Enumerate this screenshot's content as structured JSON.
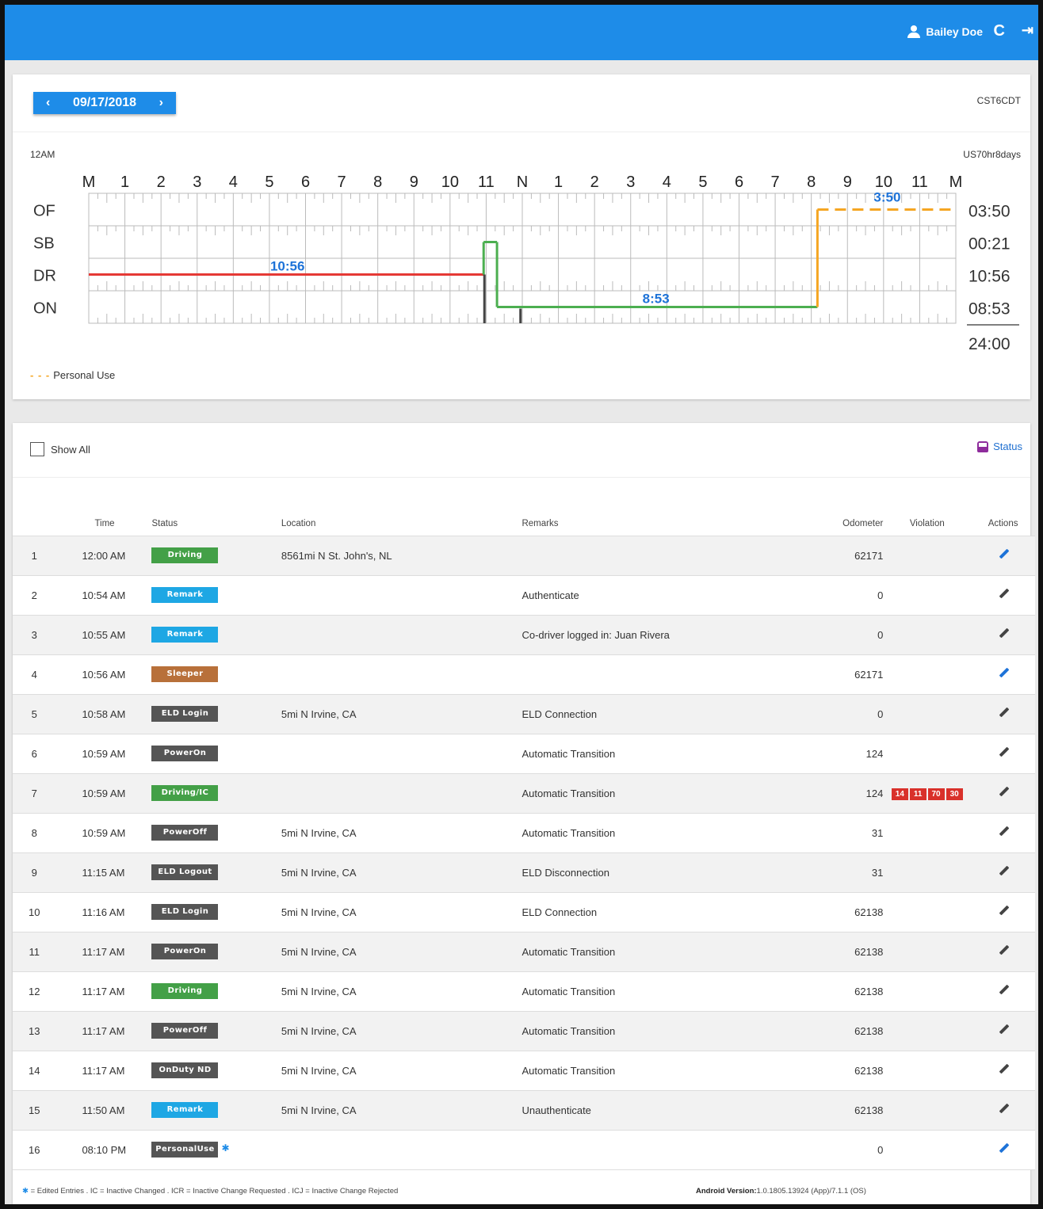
{
  "header": {
    "user_name": "Bailey Doe",
    "refresh_icon": "C",
    "logout_icon": "⇥"
  },
  "chart": {
    "date": "09/17/2018",
    "timezone": "CST6CDT",
    "start_label": "12AM",
    "ruleset": "US70hr8days",
    "hour_labels": [
      "M",
      "1",
      "2",
      "3",
      "4",
      "5",
      "6",
      "7",
      "8",
      "9",
      "10",
      "11",
      "N",
      "1",
      "2",
      "3",
      "4",
      "5",
      "6",
      "7",
      "8",
      "9",
      "10",
      "11",
      "M"
    ],
    "rows": [
      "OF",
      "SB",
      "DR",
      "ON"
    ],
    "totals": [
      "03:50",
      "00:21",
      "10:56",
      "08:53"
    ],
    "grand_total": "24:00",
    "duration_labels": {
      "dr": "10:56",
      "on": "8:53",
      "of": "3:50"
    },
    "legend": "Personal Use",
    "colors": {
      "driving": "#e53935",
      "onduty": "#4caf50",
      "personal": "#f5a623",
      "label": "#1e73d8"
    }
  },
  "chart_data": {
    "type": "line",
    "title": "",
    "xlabel": "",
    "ylabel": "",
    "xlim": [
      0,
      24
    ],
    "categories": [
      "OF",
      "SB",
      "DR",
      "ON"
    ],
    "series": [
      {
        "name": "",
        "status": "DR",
        "start_hour": 0.0,
        "end_hour": 10.93
      },
      {
        "name": "",
        "status": "SB",
        "start_hour": 10.93,
        "end_hour": 11.3
      },
      {
        "name": "",
        "status": "ON",
        "start_hour": 11.3,
        "end_hour": 20.17
      },
      {
        "name": "Personal Use",
        "status": "OF",
        "start_hour": 20.17,
        "end_hour": 24.0
      }
    ]
  },
  "log": {
    "show_all_label": "Show All",
    "status_link": "Status",
    "columns": [
      "",
      "Time",
      "Status",
      "Location",
      "Remarks",
      "Odometer",
      "Violation",
      "Actions"
    ],
    "rows": [
      {
        "num": "1",
        "time": "12:00 AM",
        "status": "Driving",
        "color": "#43a047",
        "location": "8561mi N St. John's, NL",
        "remarks": "",
        "odometer": "62171",
        "violations": [],
        "action": "blue",
        "edited": false
      },
      {
        "num": "2",
        "time": "10:54 AM",
        "status": "Remark",
        "color": "#1ea7e4",
        "location": "",
        "remarks": "Authenticate",
        "odometer": "0",
        "violations": [],
        "action": "dark",
        "edited": false
      },
      {
        "num": "3",
        "time": "10:55 AM",
        "status": "Remark",
        "color": "#1ea7e4",
        "location": "",
        "remarks": "Co-driver logged in: Juan Rivera",
        "odometer": "0",
        "violations": [],
        "action": "dark",
        "edited": false
      },
      {
        "num": "4",
        "time": "10:56 AM",
        "status": "Sleeper",
        "color": "#b8703a",
        "location": "",
        "remarks": "",
        "odometer": "62171",
        "violations": [],
        "action": "blue",
        "edited": false
      },
      {
        "num": "5",
        "time": "10:58 AM",
        "status": "ELD Login",
        "color": "#555555",
        "location": "5mi N Irvine, CA",
        "remarks": "ELD Connection",
        "odometer": "0",
        "violations": [],
        "action": "dark",
        "edited": false
      },
      {
        "num": "6",
        "time": "10:59 AM",
        "status": "PowerOn",
        "color": "#555555",
        "location": "",
        "remarks": "Automatic Transition",
        "odometer": "124",
        "violations": [],
        "action": "dark",
        "edited": false
      },
      {
        "num": "7",
        "time": "10:59 AM",
        "status": "Driving/IC",
        "color": "#43a047",
        "location": "",
        "remarks": "Automatic Transition",
        "odometer": "124",
        "violations": [
          "14",
          "11",
          "70",
          "30"
        ],
        "action": "dark",
        "edited": false
      },
      {
        "num": "8",
        "time": "10:59 AM",
        "status": "PowerOff",
        "color": "#555555",
        "location": "5mi N Irvine, CA",
        "remarks": "Automatic Transition",
        "odometer": "31",
        "violations": [],
        "action": "dark",
        "edited": false
      },
      {
        "num": "9",
        "time": "11:15 AM",
        "status": "ELD Logout",
        "color": "#555555",
        "location": "5mi N Irvine, CA",
        "remarks": "ELD Disconnection",
        "odometer": "31",
        "violations": [],
        "action": "dark",
        "edited": false
      },
      {
        "num": "10",
        "time": "11:16 AM",
        "status": "ELD Login",
        "color": "#555555",
        "location": "5mi N Irvine, CA",
        "remarks": "ELD Connection",
        "odometer": "62138",
        "violations": [],
        "action": "dark",
        "edited": false
      },
      {
        "num": "11",
        "time": "11:17 AM",
        "status": "PowerOn",
        "color": "#555555",
        "location": "5mi N Irvine, CA",
        "remarks": "Automatic Transition",
        "odometer": "62138",
        "violations": [],
        "action": "dark",
        "edited": false
      },
      {
        "num": "12",
        "time": "11:17 AM",
        "status": "Driving",
        "color": "#43a047",
        "location": "5mi N Irvine, CA",
        "remarks": "Automatic Transition",
        "odometer": "62138",
        "violations": [],
        "action": "dark",
        "edited": false
      },
      {
        "num": "13",
        "time": "11:17 AM",
        "status": "PowerOff",
        "color": "#555555",
        "location": "5mi N Irvine, CA",
        "remarks": "Automatic Transition",
        "odometer": "62138",
        "violations": [],
        "action": "dark",
        "edited": false
      },
      {
        "num": "14",
        "time": "11:17 AM",
        "status": "OnDuty ND",
        "color": "#555555",
        "location": "5mi N Irvine, CA",
        "remarks": "Automatic Transition",
        "odometer": "62138",
        "violations": [],
        "action": "dark",
        "edited": false
      },
      {
        "num": "15",
        "time": "11:50 AM",
        "status": "Remark",
        "color": "#1ea7e4",
        "location": "5mi N Irvine, CA",
        "remarks": "Unauthenticate",
        "odometer": "62138",
        "violations": [],
        "action": "dark",
        "edited": false
      },
      {
        "num": "16",
        "time": "08:10 PM",
        "status": "PersonalUse",
        "color": "#555555",
        "location": "",
        "remarks": "",
        "odometer": "0",
        "violations": [],
        "action": "blue",
        "edited": true
      }
    ]
  },
  "footer": {
    "star": "✱",
    "legend_text": " = Edited Entries . IC = Inactive Changed . ICR = Inactive Change Requested . ICJ = Inactive Change Rejected",
    "android_label": "Android Version:",
    "android_value": "1.0.1805.13924 (App)/7.1.1 (OS)"
  }
}
